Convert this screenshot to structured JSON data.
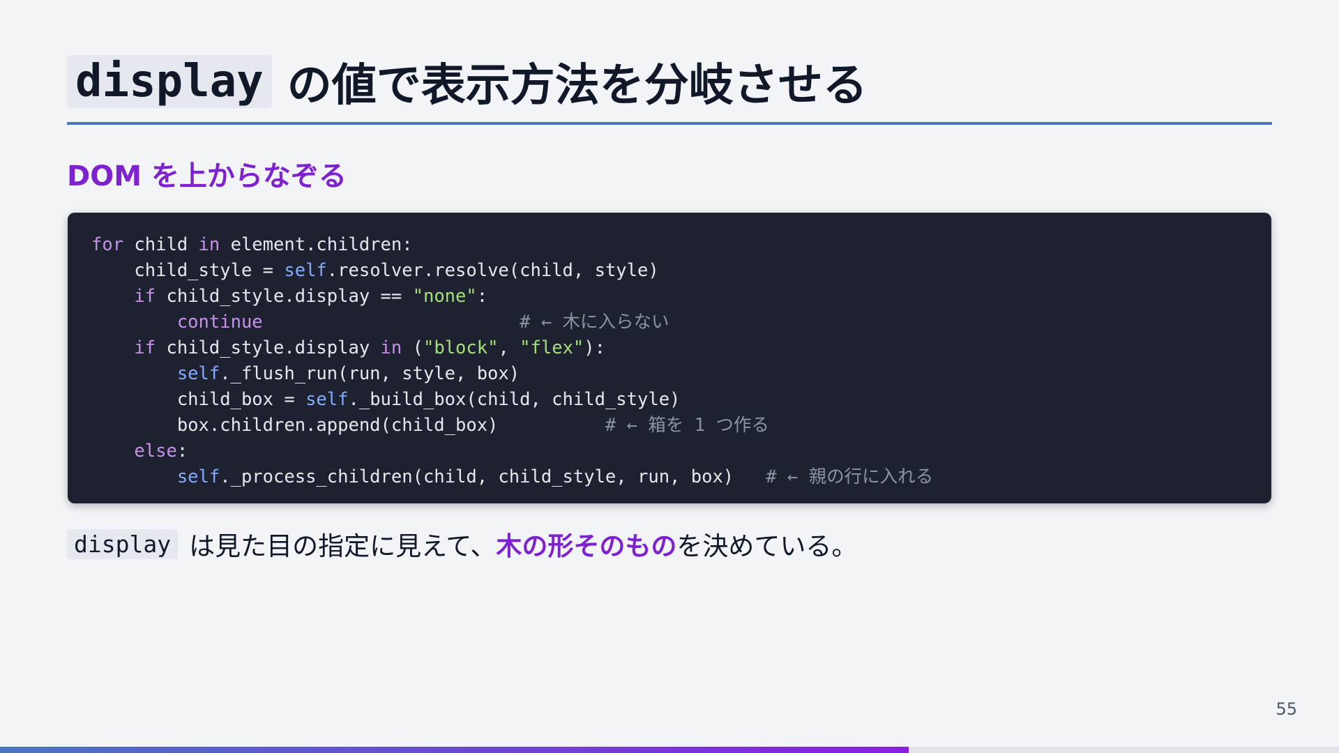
{
  "title": {
    "code": "display",
    "text": "の値で表示方法を分岐させる"
  },
  "subtitle": "DOM を上からなぞる",
  "code_lines": [
    {
      "indent": "",
      "tokens": [
        {
          "t": "kw",
          "v": "for"
        },
        {
          "t": "pl",
          "v": " child "
        },
        {
          "t": "kw",
          "v": "in"
        },
        {
          "t": "pl",
          "v": " element.children:"
        }
      ]
    },
    {
      "indent": "    ",
      "tokens": [
        {
          "t": "pl",
          "v": "child_style = "
        },
        {
          "t": "slf",
          "v": "self"
        },
        {
          "t": "pl",
          "v": ".resolver.resolve(child, style)"
        }
      ]
    },
    {
      "indent": "    ",
      "tokens": [
        {
          "t": "kw",
          "v": "if"
        },
        {
          "t": "pl",
          "v": " child_style.display == "
        },
        {
          "t": "str",
          "v": "\"none\""
        },
        {
          "t": "pl",
          "v": ":"
        }
      ]
    },
    {
      "indent": "        ",
      "tokens": [
        {
          "t": "kw",
          "v": "continue"
        },
        {
          "t": "pl",
          "v": "                        "
        },
        {
          "t": "cmt",
          "v": "# ← 木に入らない"
        }
      ]
    },
    {
      "indent": "    ",
      "tokens": [
        {
          "t": "kw",
          "v": "if"
        },
        {
          "t": "pl",
          "v": " child_style.display "
        },
        {
          "t": "kw",
          "v": "in"
        },
        {
          "t": "pl",
          "v": " ("
        },
        {
          "t": "str",
          "v": "\"block\""
        },
        {
          "t": "pl",
          "v": ", "
        },
        {
          "t": "str",
          "v": "\"flex\""
        },
        {
          "t": "pl",
          "v": "):"
        }
      ]
    },
    {
      "indent": "        ",
      "tokens": [
        {
          "t": "slf",
          "v": "self"
        },
        {
          "t": "pl",
          "v": "._flush_run(run, style, box)"
        }
      ]
    },
    {
      "indent": "        ",
      "tokens": [
        {
          "t": "pl",
          "v": "child_box = "
        },
        {
          "t": "slf",
          "v": "self"
        },
        {
          "t": "pl",
          "v": "._build_box(child, child_style)"
        }
      ]
    },
    {
      "indent": "        ",
      "tokens": [
        {
          "t": "pl",
          "v": "box.children.append(child_box)          "
        },
        {
          "t": "cmt",
          "v": "# ← 箱を 1 つ作る"
        }
      ]
    },
    {
      "indent": "    ",
      "tokens": [
        {
          "t": "kw",
          "v": "else"
        },
        {
          "t": "pl",
          "v": ":"
        }
      ]
    },
    {
      "indent": "        ",
      "tokens": [
        {
          "t": "slf",
          "v": "self"
        },
        {
          "t": "pl",
          "v": "._process_children(child, child_style, run, box)   "
        },
        {
          "t": "cmt",
          "v": "# ← 親の行に入れる"
        }
      ]
    }
  ],
  "caption": {
    "code": "display",
    "before": "は見た目の指定に見えて、",
    "emphasis": "木の形そのもの",
    "after": "を決めている。"
  },
  "page_number": "55",
  "progress": 0.6785,
  "colors": {
    "accent_purple": "#7e22ce",
    "rule_blue": "#4a74c4",
    "code_bg": "#1e2230",
    "keyword": "#c792ea",
    "self": "#82aaff",
    "string": "#a5e07a",
    "comment": "#8b93a7"
  }
}
